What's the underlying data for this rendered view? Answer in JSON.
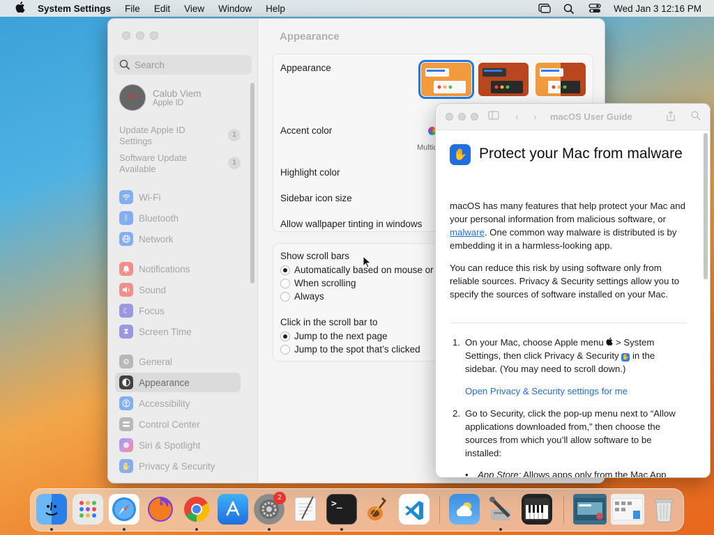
{
  "menubar": {
    "app_name": "System Settings",
    "items": [
      "File",
      "Edit",
      "View",
      "Window",
      "Help"
    ],
    "clock": "Wed Jan 3  12:16 PM"
  },
  "settings": {
    "search_placeholder": "Search",
    "account": {
      "name": "Calub Viem",
      "sub": "Apple ID"
    },
    "updates": [
      {
        "label": "Update Apple ID Settings",
        "count": "1"
      },
      {
        "label": "Software Update Available",
        "count": "1"
      }
    ],
    "sidebar": [
      {
        "label": "Wi-Fi",
        "icon": "wifi-icon",
        "color": "#2f7cf6"
      },
      {
        "label": "Bluetooth",
        "icon": "bluetooth-icon",
        "color": "#2f7cf6"
      },
      {
        "label": "Network",
        "icon": "globe-icon",
        "color": "#2f7cf6"
      },
      {
        "label": "Notifications",
        "icon": "bell-icon",
        "color": "#f2453d"
      },
      {
        "label": "Sound",
        "icon": "speaker-icon",
        "color": "#f2453d"
      },
      {
        "label": "Focus",
        "icon": "moon-icon",
        "color": "#5b54d6"
      },
      {
        "label": "Screen Time",
        "icon": "hourglass-icon",
        "color": "#5b54d6"
      },
      {
        "label": "General",
        "icon": "gear-icon",
        "color": "#8e8e93"
      },
      {
        "label": "Appearance",
        "icon": "appearance-icon",
        "color": "#1c1c1e"
      },
      {
        "label": "Accessibility",
        "icon": "accessibility-icon",
        "color": "#2f7cf6"
      },
      {
        "label": "Control Center",
        "icon": "control-center-icon",
        "color": "#8e8e93"
      },
      {
        "label": "Siri & Spotlight",
        "icon": "siri-icon",
        "color": "#c04bd8"
      },
      {
        "label": "Privacy & Security",
        "icon": "hand-icon",
        "color": "#2f7cf6"
      }
    ],
    "pane_title": "Appearance",
    "rows": {
      "appearance": "Appearance",
      "accent": "Accent color",
      "multicolor": "Multic",
      "highlight": "Highlight color",
      "icon_size": "Sidebar icon size",
      "tinting": "Allow wallpaper tinting in windows"
    },
    "scrollbars": {
      "title": "Show scroll bars",
      "options": [
        "Automatically based on mouse or",
        "When scrolling",
        "Always"
      ],
      "selected": 0
    },
    "click": {
      "title": "Click in the scroll bar to",
      "options": [
        "Jump to the next page",
        "Jump to the spot that’s clicked"
      ],
      "selected": 0
    }
  },
  "guide": {
    "title": "macOS User Guide",
    "heading": "Protect your Mac from malware",
    "p1_a": "macOS has many features that help protect your Mac and your personal information from malicious software, or ",
    "p1_link": "malware",
    "p1_b": ". One common way malware is distributed is by embedding it in a harmless-looking app.",
    "p2": "You can reduce this risk by using software only from reliable sources. Privacy & Security settings allow you to specify the sources of software installed on your Mac.",
    "step1_num": "1.",
    "step1_a": "On your Mac, choose Apple menu",
    "step1_b": "> System Settings, then click Privacy & Security",
    "step1_c": "in the sidebar. (You may need to scroll down.)",
    "step1_link": "Open Privacy & Security settings for me",
    "step2_num": "2.",
    "step2": "Go to Security, click the pop-up menu next to “Allow applications downloaded from,” then choose the sources from which you’ll allow software to be installed:",
    "bullet_label": "App Store:",
    "bullet_text": "Allows apps only from the Mac App"
  },
  "dock": {
    "apps": [
      {
        "name": "Finder",
        "icon": "finder-icon",
        "color": "#3a8ef0"
      },
      {
        "name": "Launchpad",
        "icon": "launchpad-icon",
        "color": "#e8e8e8"
      },
      {
        "name": "Safari",
        "icon": "safari-icon",
        "color": "#2a8cf0"
      },
      {
        "name": "Firefox",
        "icon": "firefox-icon",
        "color": "#f0782a"
      },
      {
        "name": "Chrome",
        "icon": "chrome-icon",
        "color": "#f2f2f2"
      },
      {
        "name": "App Store",
        "icon": "app-store-icon",
        "color": "#2b8ef2"
      },
      {
        "name": "System Settings",
        "icon": "system-settings-icon",
        "color": "#8a8a8a"
      },
      {
        "name": "TextEdit",
        "icon": "textedit-icon",
        "color": "#f4f4f4"
      },
      {
        "name": "Terminal",
        "icon": "terminal-icon",
        "color": "#1e1e1e"
      },
      {
        "name": "GarageBand",
        "icon": "garageband-icon",
        "color": "#f08a2a"
      },
      {
        "name": "VS Code",
        "icon": "vscode-icon",
        "color": "#ffffff"
      },
      {
        "name": "Weather",
        "icon": "weather-icon",
        "color": "#4ea6ec"
      },
      {
        "name": "Utility",
        "icon": "utility-icon",
        "color": "#cfcfcf"
      },
      {
        "name": "Piano",
        "icon": "piano-icon",
        "color": "#222222"
      },
      {
        "name": "Window 1",
        "icon": "window-thumbnail-icon",
        "color": "#3a6f8a"
      },
      {
        "name": "Window 2",
        "icon": "window-thumbnail-icon",
        "color": "#e6e6e6"
      },
      {
        "name": "Trash",
        "icon": "trash-icon",
        "color": "#dcdcdc"
      }
    ],
    "settings_badge": "2",
    "terminal_glyph": ">_"
  }
}
